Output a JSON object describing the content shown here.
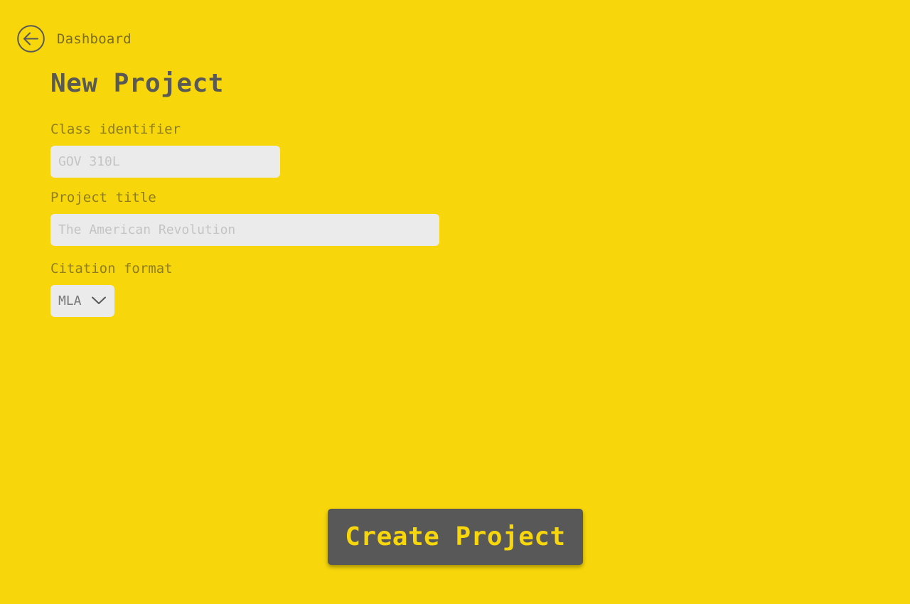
{
  "nav": {
    "back_label": "Dashboard",
    "back_icon": "arrow-left-circle-icon"
  },
  "page": {
    "title": "New Project"
  },
  "form": {
    "class_identifier": {
      "label": "Class identifier",
      "value": "",
      "placeholder": "GOV 310L"
    },
    "project_title": {
      "label": "Project title",
      "value": "",
      "placeholder": "The American Revolution"
    },
    "citation_format": {
      "label": "Citation format",
      "selected": "MLA",
      "icon": "chevron-down-icon"
    }
  },
  "actions": {
    "create_label": "Create Project"
  },
  "colors": {
    "background": "#f7d70b",
    "button": "#585858",
    "button_text": "#f7d70b",
    "input_bg": "#ebebeb"
  }
}
